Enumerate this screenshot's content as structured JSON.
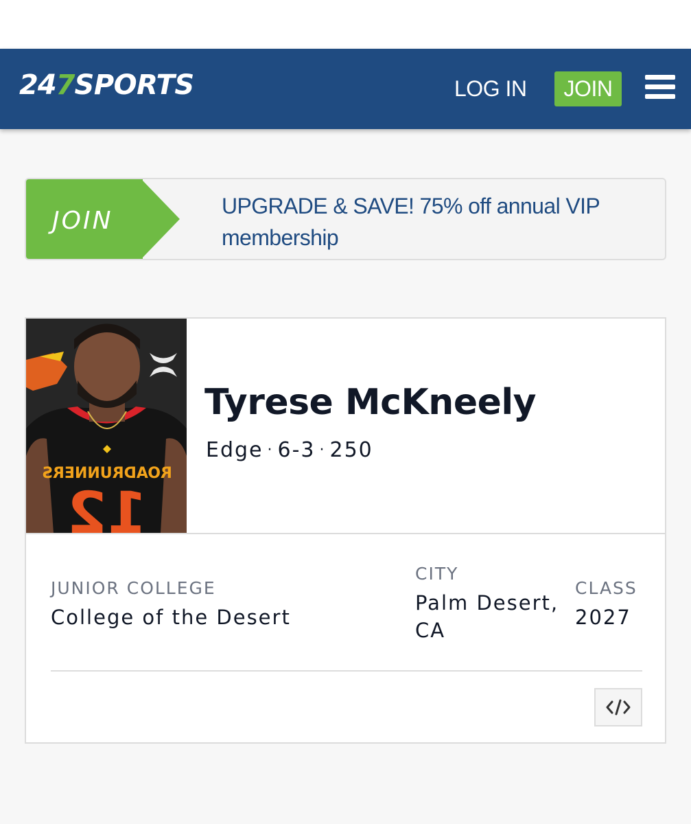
{
  "header": {
    "logo_text_a": "24",
    "logo_text_b": "7",
    "logo_text_c": "SPORTS",
    "login_label": "LOG IN",
    "join_label": "JOIN",
    "menu_icon": "hamburger-menu-icon",
    "bg_color": "#1f4b81",
    "accent_color": "#6fbb44"
  },
  "promo": {
    "tag_label": "JOIN",
    "text": "UPGRADE & SAVE! 75% off annual VIP membership"
  },
  "player": {
    "name": "Tyrese McKneely",
    "position": "Edge",
    "height": "6-3",
    "weight": "250",
    "photo_alt": "Player headshot",
    "jersey_text": "ROADRUNNERS",
    "jersey_number": "12"
  },
  "info": {
    "school_label": "JUNIOR COLLEGE",
    "school_value": "College of the Desert",
    "city_label": "CITY",
    "city_value": "Palm Desert, CA",
    "class_label": "CLASS",
    "class_value": "2027"
  },
  "embed": {
    "icon": "code-embed-icon"
  }
}
